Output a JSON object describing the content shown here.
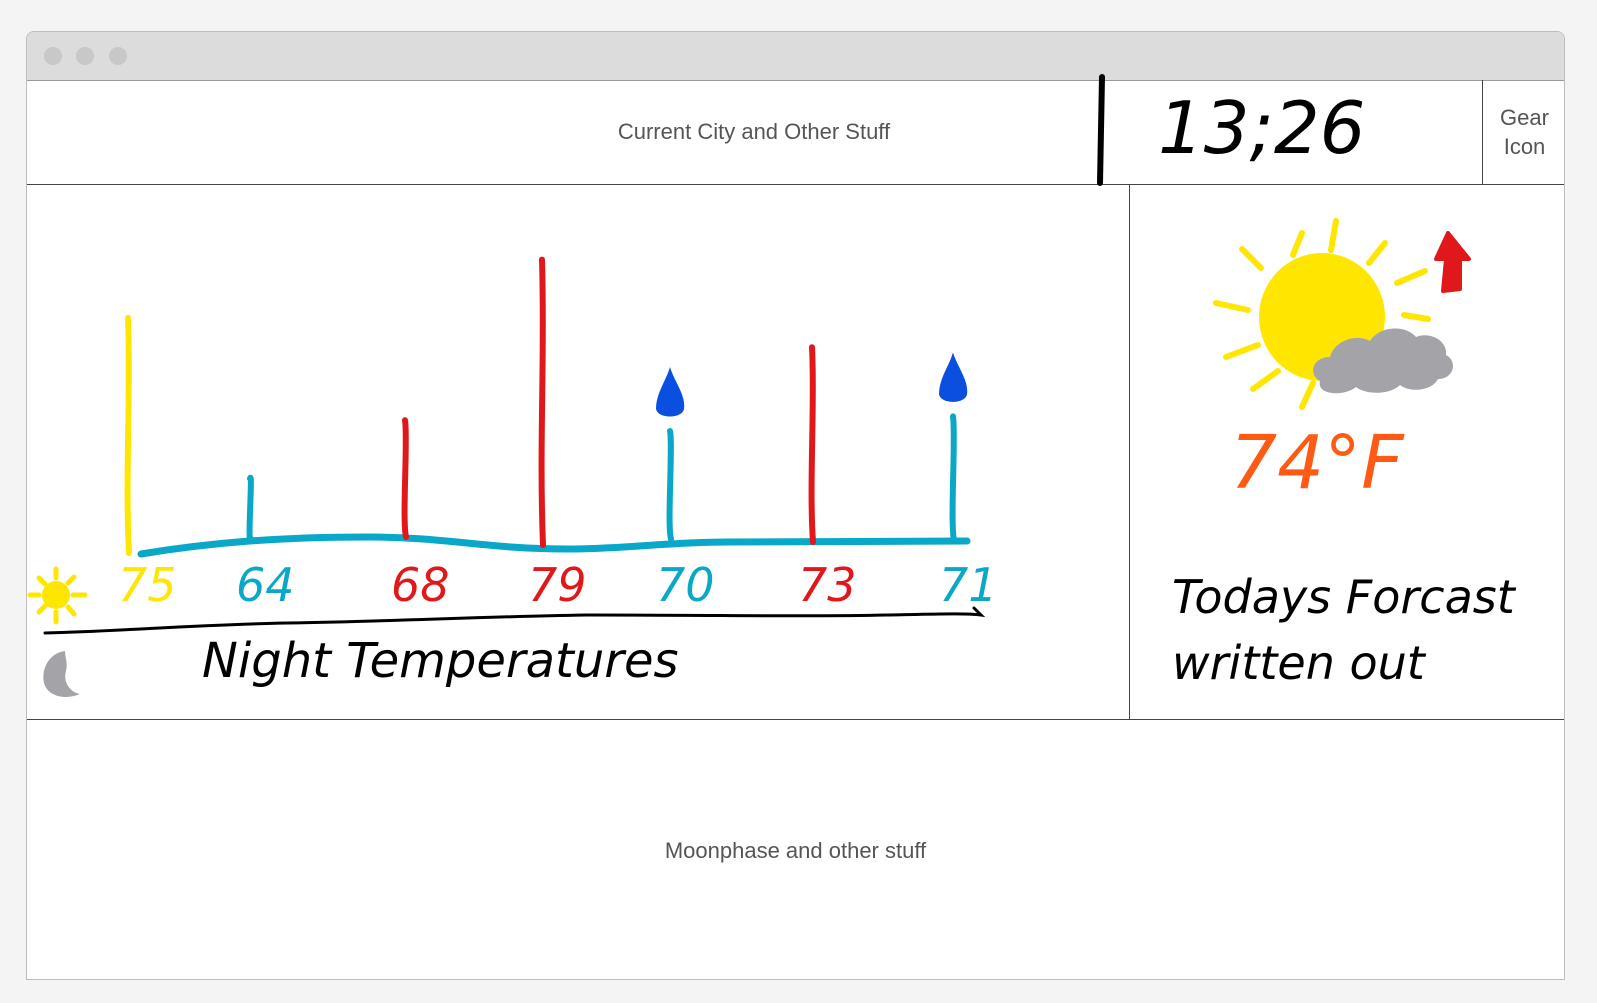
{
  "header": {
    "city_label": "Current City and Other Stuff",
    "clock": "13;26",
    "gear_line1": "Gear",
    "gear_line2": "Icon"
  },
  "chart_data": {
    "type": "bar",
    "categories": [
      "",
      "",
      "",
      "",
      "",
      "",
      ""
    ],
    "values": [
      75,
      64,
      68,
      79,
      70,
      73,
      71
    ],
    "value_labels": [
      "75",
      "64",
      "68",
      "79",
      "70",
      "73",
      "71"
    ],
    "bar_colors": [
      "#ffe600",
      "#0aa8c8",
      "#e0181b",
      "#e0181b",
      "#0aa8c8",
      "#e0181b",
      "#0aa8c8"
    ],
    "precip_icons": [
      false,
      false,
      false,
      false,
      true,
      false,
      true
    ],
    "ylabel": "",
    "title": "",
    "xlabel": "Night Temperatures",
    "ylim": [
      60,
      80
    ]
  },
  "chart_icons": {
    "day_icon": "sun-icon",
    "night_icon": "moon-icon",
    "precip_icon": "raindrop-icon"
  },
  "forecast": {
    "icon": "partly-cloudy-icon",
    "trend_icon": "up-arrow-icon",
    "temperature": "74°F",
    "line1": "Todays Forcast",
    "line2": "written out"
  },
  "footer": {
    "label": "Moonphase and other stuff"
  },
  "colors": {
    "accent_red": "#e0181b",
    "accent_cyan": "#0aa8c8",
    "accent_yellow": "#ffe600",
    "temp_orange": "#ff5a14",
    "raindrop_blue": "#0a4fe0"
  }
}
